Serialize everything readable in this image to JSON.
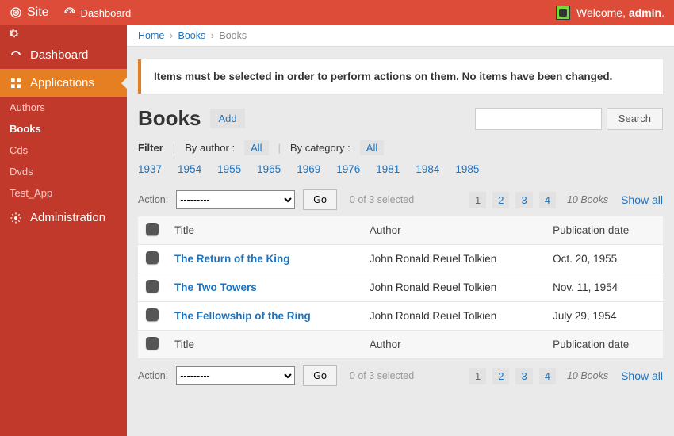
{
  "topbar": {
    "site_label": "Site",
    "crumb_dashboard": "Dashboard",
    "welcome_prefix": "Welcome, ",
    "welcome_user": "admin"
  },
  "sidebar": {
    "items": [
      {
        "icon": "dashboard-icon",
        "label": "Dashboard"
      },
      {
        "icon": "apps-icon",
        "label": "Applications",
        "active": true
      },
      {
        "icon": "admin-icon",
        "label": "Administration"
      }
    ],
    "sub_items": [
      "Authors",
      "Books",
      "Cds",
      "Dvds",
      "Test_App"
    ],
    "active_sub": "Books"
  },
  "breadcrumbs": {
    "home": "Home",
    "books_link": "Books",
    "current": "Books"
  },
  "message": "Items must be selected in order to perform actions on them. No items have been changed.",
  "heading": {
    "title": "Books",
    "add_label": "Add",
    "search_btn": "Search",
    "search_value": ""
  },
  "filter": {
    "label": "Filter",
    "by_author": "By author :",
    "by_category": "By category :",
    "all": "All",
    "years": [
      "1937",
      "1954",
      "1955",
      "1965",
      "1969",
      "1976",
      "1981",
      "1984",
      "1985"
    ]
  },
  "actionbar": {
    "label": "Action:",
    "placeholder_option": "---------",
    "go": "Go",
    "selected": "0 of 3 selected",
    "pages": [
      "1",
      "2",
      "3",
      "4"
    ],
    "count": "10 Books",
    "show_all": "Show all"
  },
  "table": {
    "cols": {
      "title": "Title",
      "author": "Author",
      "pub": "Publication date"
    },
    "rows": [
      {
        "title": "The Return of the King",
        "author": "John Ronald Reuel Tolkien",
        "pub": "Oct. 20, 1955"
      },
      {
        "title": "The Two Towers",
        "author": "John Ronald Reuel Tolkien",
        "pub": "Nov. 11, 1954"
      },
      {
        "title": "The Fellowship of the Ring",
        "author": "John Ronald Reuel Tolkien",
        "pub": "July 29, 1954"
      }
    ]
  }
}
